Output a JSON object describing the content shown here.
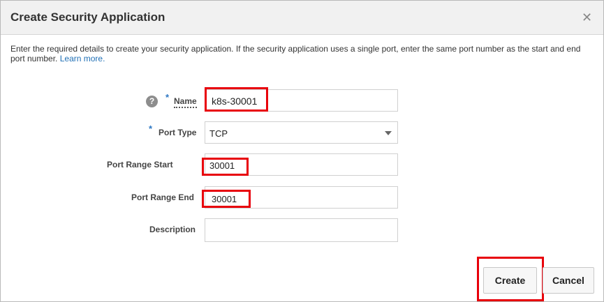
{
  "dialog": {
    "title": "Create Security Application",
    "close_icon": "close-icon",
    "intro_text": "Enter the required details to create your security application. If the security application uses a single port, enter the same port number as the start and end port number.",
    "learn_more": "Learn more."
  },
  "form": {
    "name": {
      "label": "Name",
      "required": "*",
      "value": "k8s-30001",
      "help_icon": "question-icon",
      "help_glyph": "?"
    },
    "port_type": {
      "label": "Port Type",
      "required": "*",
      "value": "TCP"
    },
    "port_range_start": {
      "label": "Port Range Start",
      "value": "30001"
    },
    "port_range_end": {
      "label": "Port Range End",
      "value": "30001"
    },
    "description": {
      "label": "Description",
      "value": ""
    }
  },
  "buttons": {
    "create": "Create",
    "cancel": "Cancel"
  },
  "colors": {
    "highlight": "#e8000b",
    "link": "#1f6fb5",
    "required": "#2f78c4"
  }
}
